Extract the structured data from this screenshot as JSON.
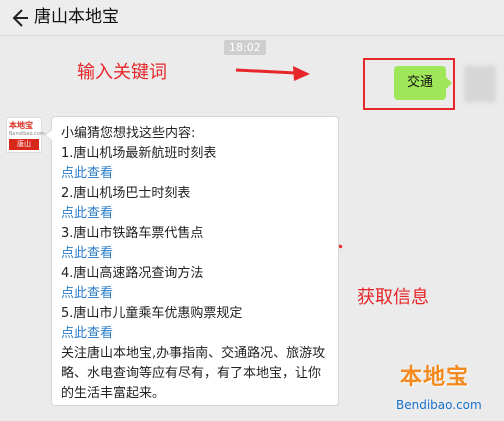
{
  "header": {
    "title": "唐山本地宝",
    "back_icon": "back-arrow-icon"
  },
  "timestamp": "18:02",
  "annotations": {
    "keyword": "输入关键词",
    "result": "获取信息",
    "color": "#e6262a"
  },
  "outgoing": {
    "text": "交通",
    "bubble_color": "#9fe658"
  },
  "logo": {
    "top_text": "本地宝",
    "mid_text": "Bendibao.com",
    "bottom_text": "唐山"
  },
  "reply": {
    "intro": "小编猜您想找这些内容:",
    "items": [
      {
        "title": "1.唐山机场最新航班时刻表",
        "link": "点此查看"
      },
      {
        "title": "2.唐山机场巴士时刻表",
        "link": "点此查看"
      },
      {
        "title": "3.唐山市铁路车票代售点",
        "link": "点此查看"
      },
      {
        "title": "4.唐山高速路况查询方法",
        "link": "点此查看"
      },
      {
        "title": "5.唐山市儿童乘车优惠购票规定",
        "link": "点此查看"
      }
    ],
    "footer": "关注唐山本地宝,办事指南、交通路况、旅游攻略、水电查询等应有尽有，有了本地宝，让你的生活丰富起来。",
    "link_color": "#2b7dc7"
  },
  "watermark": {
    "main": "本地宝",
    "url": "Bendibao.com"
  }
}
